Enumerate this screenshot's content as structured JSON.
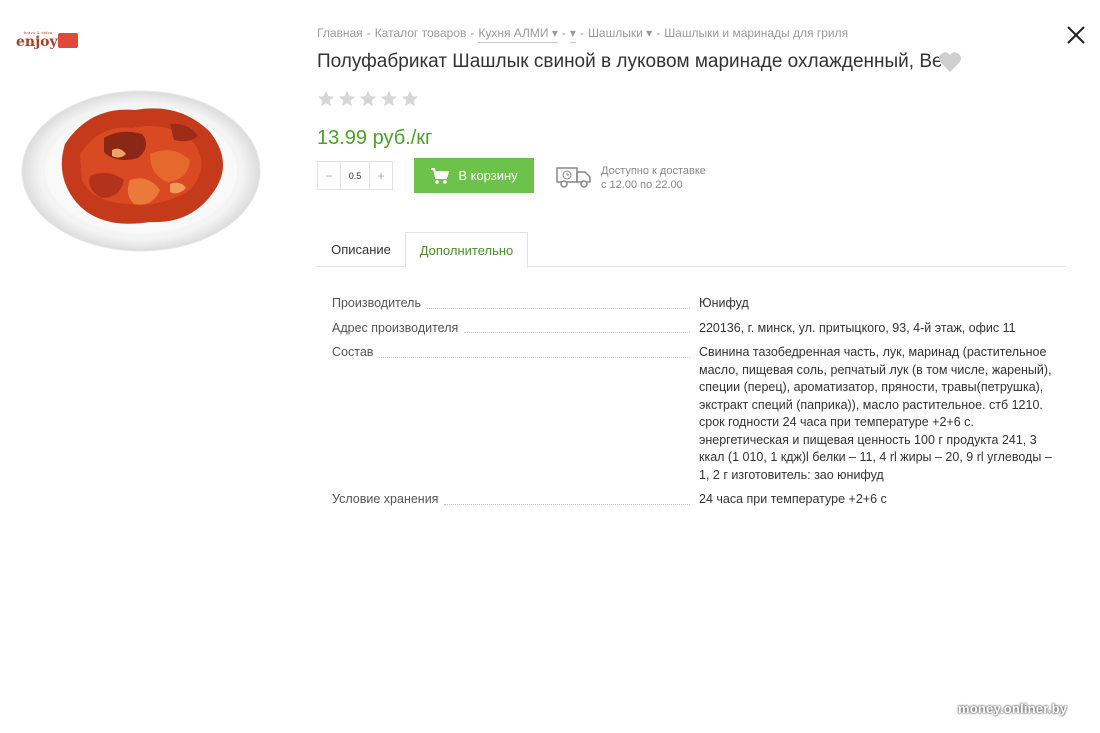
{
  "logo": {
    "top_text": "bravo & delka",
    "brand": "enjoy"
  },
  "breadcrumb": [
    {
      "label": "Главная",
      "dropdown": false
    },
    {
      "label": "Каталог товаров",
      "dropdown": false
    },
    {
      "label": "Кухня АЛМИ",
      "dropdown": true
    },
    {
      "label": "",
      "dropdown": true
    },
    {
      "label": "Шашлыки",
      "dropdown": true
    },
    {
      "label": "Шашлыки и маринады для гриля",
      "dropdown": false
    }
  ],
  "product": {
    "title": "Полуфабрикат Шашлык свиной в луковом маринаде охлажденный, Вес",
    "rating": 0,
    "rating_max": 5,
    "price": "13.99 руб./кг",
    "quantity": "0.5",
    "add_to_cart": "В корзину",
    "delivery_line1": "Доступно к доставке",
    "delivery_line2": "с 12.00 по 22.00"
  },
  "tabs": [
    {
      "label": "Описание",
      "active": false
    },
    {
      "label": "Дополнительно",
      "active": true
    }
  ],
  "specs": [
    {
      "key": "Производитель",
      "value": "Юнифуд"
    },
    {
      "key": "Адрес производителя",
      "value": "220136, г. минск, ул. притыцкого, 93, 4-й этаж, офис 11"
    },
    {
      "key": "Состав",
      "value": "Свинина тазобедренная часть, лук, маринад (растительное масло, пищевая соль, репчатый лук (в том числе, жареный), специи (перец), ароматизатор, пряности, травы(петрушка), экстракт специй (паприка)), масло растительное. стб 1210. срок годности 24 часа при температуре +2+6 с. энергетическая и пищевая ценность 100 г продукта 241, 3 ккал (1 010, 1 кдж)l белки – 11, 4 rl жиры – 20, 9 rl углеводы – 1, 2 г изготовитель: зао юнифуд"
    },
    {
      "key": "Условие хранения",
      "value": "24 часа при температуре +2+6 с"
    }
  ],
  "watermark": "money.onliner.by",
  "colors": {
    "accent_green": "#6cc24a",
    "price_green": "#4aa324",
    "tab_active": "#4a8f2a"
  }
}
